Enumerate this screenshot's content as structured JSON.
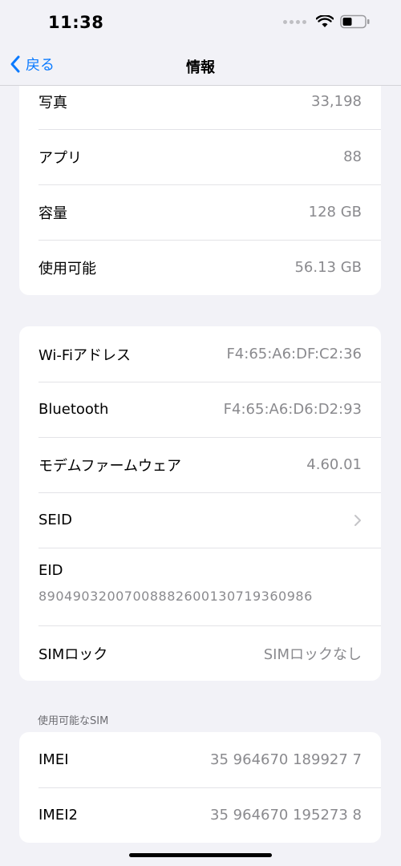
{
  "status_bar": {
    "time": "11:38",
    "icons": [
      "signal-dots-icon",
      "wifi-icon",
      "battery-icon"
    ]
  },
  "nav": {
    "back_label": "戻る",
    "title": "情報"
  },
  "group1": [
    {
      "label": "写真",
      "value": "33,198"
    },
    {
      "label": "アプリ",
      "value": "88"
    },
    {
      "label": "容量",
      "value": "128 GB"
    },
    {
      "label": "使用可能",
      "value": "56.13 GB"
    }
  ],
  "group2": {
    "wifi": {
      "label": "Wi-Fiアドレス",
      "value": "F4:65:A6:DF:C2:36"
    },
    "bluetooth": {
      "label": "Bluetooth",
      "value": "F4:65:A6:D6:D2:93"
    },
    "modem": {
      "label": "モデムファームウェア",
      "value": "4.60.01"
    },
    "seid": {
      "label": "SEID"
    },
    "eid": {
      "label": "EID",
      "value": "89049032007008882600130719360986"
    },
    "sim_lock": {
      "label": "SIMロック",
      "value": "SIMロックなし"
    }
  },
  "group3": {
    "header": "使用可能なSIM",
    "rows": [
      {
        "label": "IMEI",
        "value": "35 964670 189927 7"
      },
      {
        "label": "IMEI2",
        "value": "35 964670 195273 8"
      }
    ]
  },
  "colors": {
    "accent": "#0a7aff",
    "background": "#f2f2f7",
    "secondary_text": "#8a8a8e"
  }
}
